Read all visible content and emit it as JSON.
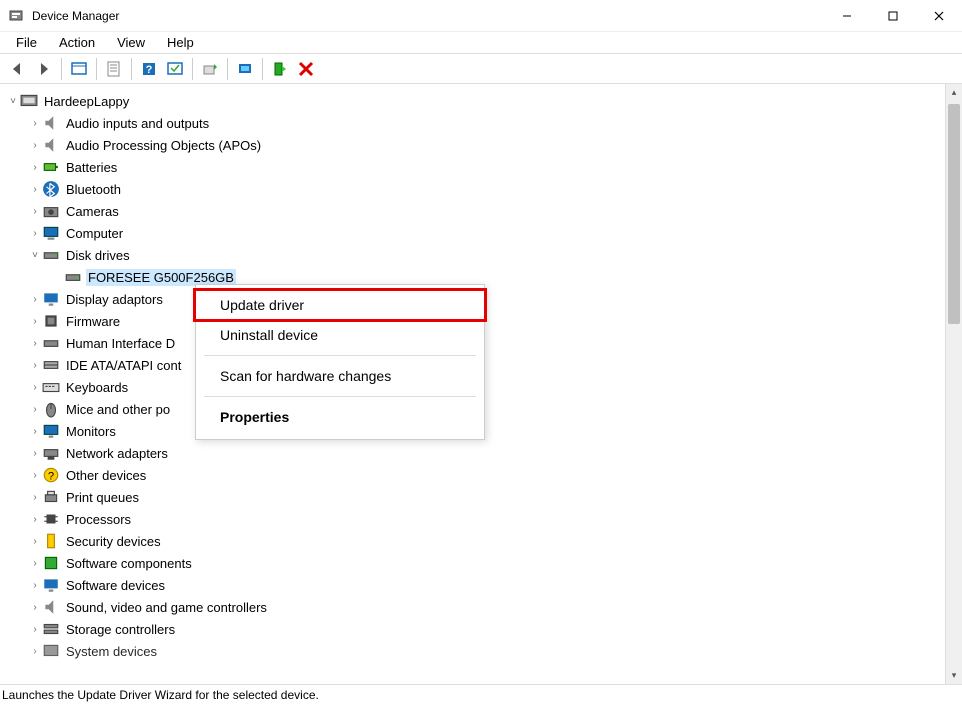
{
  "title": "Device Manager",
  "menus": [
    "File",
    "Action",
    "View",
    "Help"
  ],
  "toolbar": {
    "back": "back-arrow",
    "forward": "forward-arrow",
    "show_hidden": "show-hidden",
    "properties": "properties",
    "help": "help",
    "details": "details",
    "update": "update-driver",
    "monitor": "scan-hardware",
    "enable": "enable-device",
    "delete": "uninstall-device"
  },
  "tree": {
    "root": {
      "label": "HardeepLappy",
      "expanded": true
    },
    "nodes": [
      {
        "label": "Audio inputs and outputs",
        "icon": "audio",
        "expander": ">"
      },
      {
        "label": "Audio Processing Objects (APOs)",
        "icon": "audio",
        "expander": ">"
      },
      {
        "label": "Batteries",
        "icon": "battery",
        "expander": ">"
      },
      {
        "label": "Bluetooth",
        "icon": "bluetooth",
        "expander": ">"
      },
      {
        "label": "Cameras",
        "icon": "camera",
        "expander": ">"
      },
      {
        "label": "Computer",
        "icon": "computer",
        "expander": ">"
      },
      {
        "label": "Disk drives",
        "icon": "disk",
        "expander": "v",
        "children": [
          {
            "label": "FORESEE G500F256GB",
            "icon": "disk",
            "selected": true
          }
        ]
      },
      {
        "label": "Display adaptors",
        "icon": "display",
        "expander": ">"
      },
      {
        "label": "Firmware",
        "icon": "firmware",
        "expander": ">"
      },
      {
        "label": "Human Interface Devices",
        "icon": "hid",
        "expander": ">",
        "truncated": "Human Interface D"
      },
      {
        "label": "IDE ATA/ATAPI controllers",
        "icon": "ide",
        "expander": ">",
        "truncated": "IDE ATA/ATAPI cont"
      },
      {
        "label": "Keyboards",
        "icon": "keyboard",
        "expander": ">"
      },
      {
        "label": "Mice and other pointing devices",
        "icon": "mouse",
        "expander": ">",
        "truncated": "Mice and other po"
      },
      {
        "label": "Monitors",
        "icon": "monitor",
        "expander": ">"
      },
      {
        "label": "Network adapters",
        "icon": "network",
        "expander": ">"
      },
      {
        "label": "Other devices",
        "icon": "other",
        "expander": ">"
      },
      {
        "label": "Print queues",
        "icon": "printer",
        "expander": ">"
      },
      {
        "label": "Processors",
        "icon": "cpu",
        "expander": ">"
      },
      {
        "label": "Security devices",
        "icon": "security",
        "expander": ">"
      },
      {
        "label": "Software components",
        "icon": "swcomp",
        "expander": ">"
      },
      {
        "label": "Software devices",
        "icon": "swdev",
        "expander": ">"
      },
      {
        "label": "Sound, video and game controllers",
        "icon": "sound",
        "expander": ">"
      },
      {
        "label": "Storage controllers",
        "icon": "storage",
        "expander": ">"
      },
      {
        "label": "System devices",
        "icon": "system",
        "expander": ">",
        "truncated": "System devices"
      }
    ]
  },
  "context_menu": {
    "items": [
      {
        "label": "Update driver",
        "highlight": true
      },
      {
        "label": "Uninstall device"
      },
      {
        "sep": true
      },
      {
        "label": "Scan for hardware changes"
      },
      {
        "sep": true
      },
      {
        "label": "Properties",
        "bold": true
      }
    ]
  },
  "statusbar": "Launches the Update Driver Wizard for the selected device."
}
